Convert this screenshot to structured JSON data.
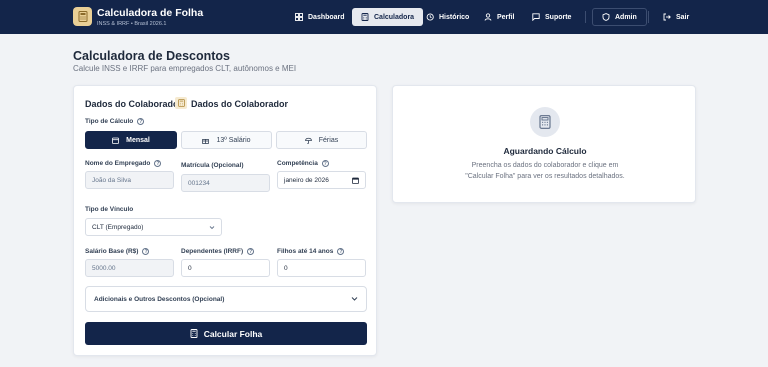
{
  "brand": {
    "title": "Calculadora de Folha",
    "subtitle": "INSS & IRRF • Brasil 2026.1"
  },
  "nav": {
    "dashboard": "Dashboard",
    "calculadora": "Calculadora",
    "historico": "Histórico",
    "perfil": "Perfil",
    "suporte": "Suporte",
    "admin": "Admin",
    "sair": "Sair"
  },
  "page": {
    "title": "Calculadora de Descontos",
    "subtitle": "Calcule INSS e IRRF para empregados CLT, autônomos e MEI"
  },
  "form": {
    "heading_left": "Dados do Colaborador",
    "heading_right": "Dados do Colaborador",
    "tipo_calculo_label": "Tipo de Cálculo",
    "tipo_options": [
      "Mensal",
      "13º Salário",
      "Férias"
    ],
    "selected_tipo": "Mensal",
    "nome_label": "Nome do Empregado",
    "nome_placeholder": "João da Silva",
    "matricula_label": "Matrícula (Opcional)",
    "matricula_placeholder": "001234",
    "competencia_label": "Competência",
    "competencia_value": "janeiro de 2026",
    "vinculo_label": "Tipo de Vínculo",
    "vinculo_value": "CLT (Empregado)",
    "salario_label": "Salário Base (R$)",
    "salario_placeholder": "5000.00",
    "dependentes_label": "Dependentes (IRRF)",
    "dependentes_value": "0",
    "filhos_label": "Filhos até 14 anos",
    "filhos_value": "0",
    "adicionais_label": "Adicionais e Outros Descontos (Opcional)",
    "submit_label": "Calcular Folha"
  },
  "result": {
    "title": "Aguardando Cálculo",
    "description_line1": "Preencha os dados do colaborador e clique em",
    "description_line2": "\"Calcular Folha\" para ver os resultados detalhados."
  },
  "colors": {
    "navy": "#13254a",
    "gold": "#e9cf96",
    "background": "#f1f3f6"
  }
}
